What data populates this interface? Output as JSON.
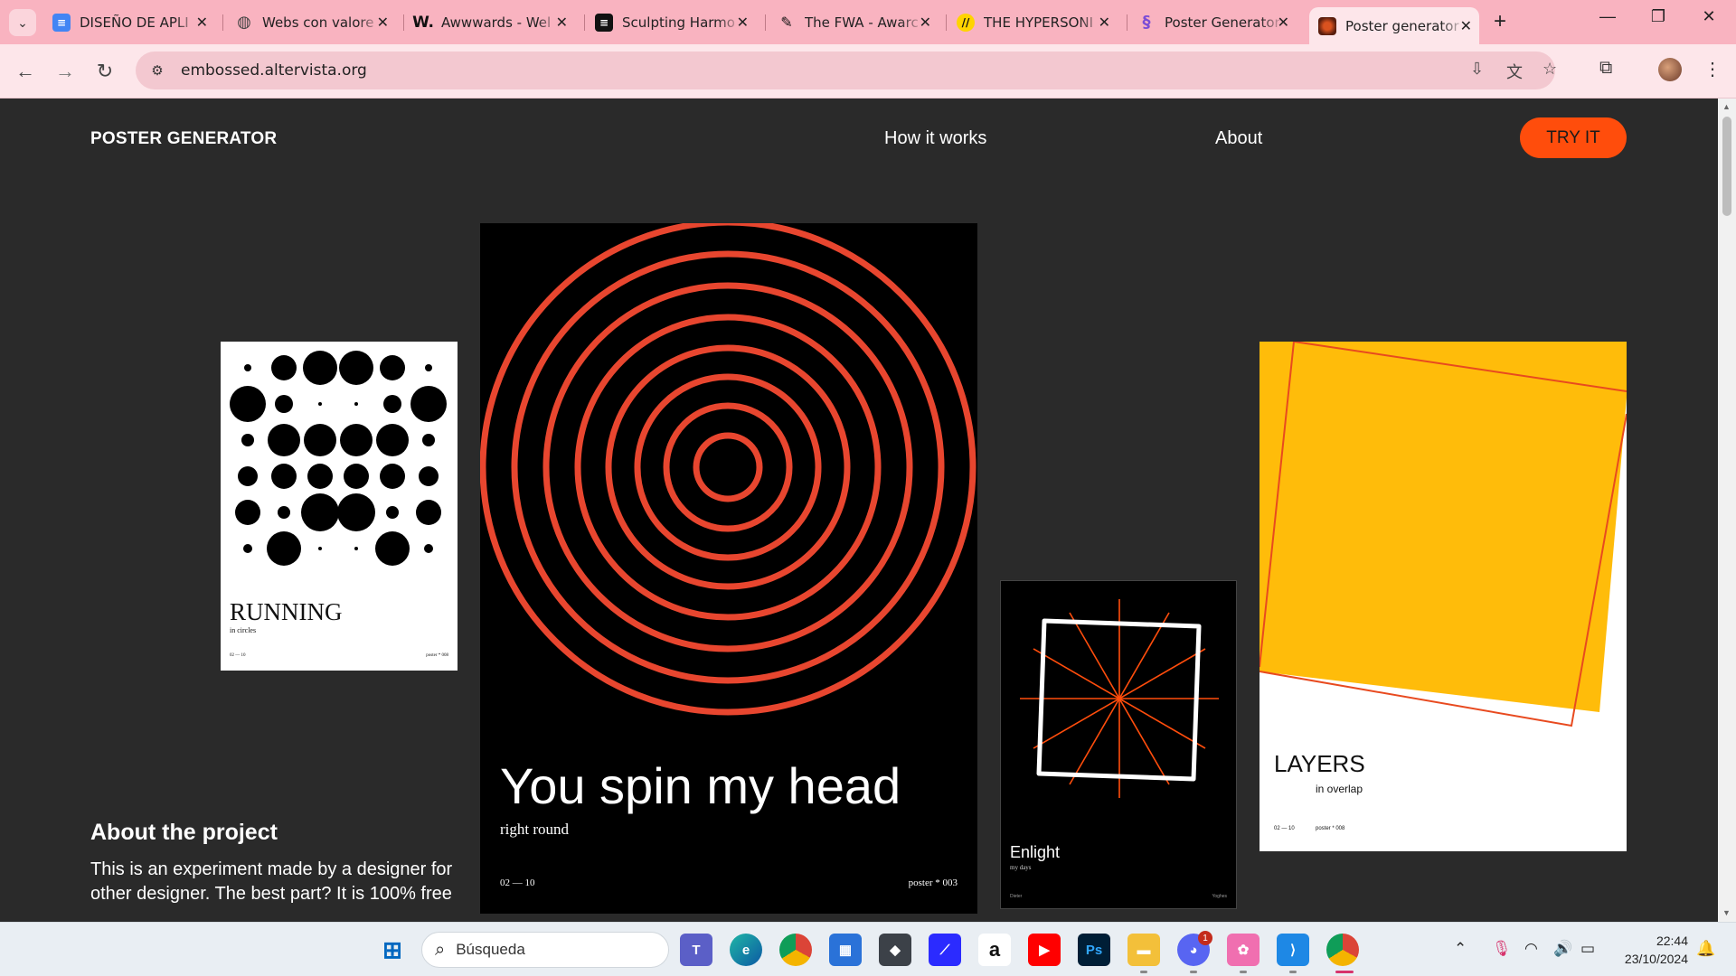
{
  "browser": {
    "tabs": [
      {
        "title": "DISEÑO DE APLI",
        "icon": "google-docs-icon"
      },
      {
        "title": "Webs con valore",
        "icon": "globe-icon"
      },
      {
        "title": "Awwwards - Wel",
        "icon": "awwwards-icon"
      },
      {
        "title": "Sculpting Harmo",
        "icon": "sculpting-icon"
      },
      {
        "title": "The FWA - Awarc",
        "icon": "fwa-icon"
      },
      {
        "title": "THE HYPERSONI",
        "icon": "hypersonic-icon"
      },
      {
        "title": "Poster Generator",
        "icon": "poster-generator-icon"
      },
      {
        "title": "Poster generator",
        "icon": "poster-generator-active-icon"
      }
    ],
    "url": "embossed.altervista.org"
  },
  "site": {
    "brand": "POSTER GENERATOR",
    "nav": [
      "How it works",
      "About"
    ],
    "cta": "TRY IT",
    "about_title": "About the project",
    "about_text": "This is an experiment made by a designer for other designer. The best part? It is 100% free"
  },
  "posters": {
    "running": {
      "title": "RUNNING",
      "subtitle": "in circles",
      "range": "02 — 10",
      "number": "poster * 008"
    },
    "spin": {
      "title": "You spin my head",
      "subtitle": "right round",
      "range": "02 — 10",
      "number": "poster * 003",
      "accent": "#e8462f"
    },
    "enlight": {
      "title": "Enlight",
      "subtitle": "my days",
      "left_caption": "Dieter",
      "right_caption": "Yoghes",
      "accent": "#ff4d0c"
    },
    "layers": {
      "title": "LAYERS",
      "subtitle": "in overlap",
      "range": "02 — 10",
      "number": "poster * 008",
      "accent": "#ffbc0a"
    }
  },
  "taskbar": {
    "search_placeholder": "Búsqueda",
    "time": "22:44",
    "date": "23/10/2024",
    "discord_badge": "1"
  }
}
